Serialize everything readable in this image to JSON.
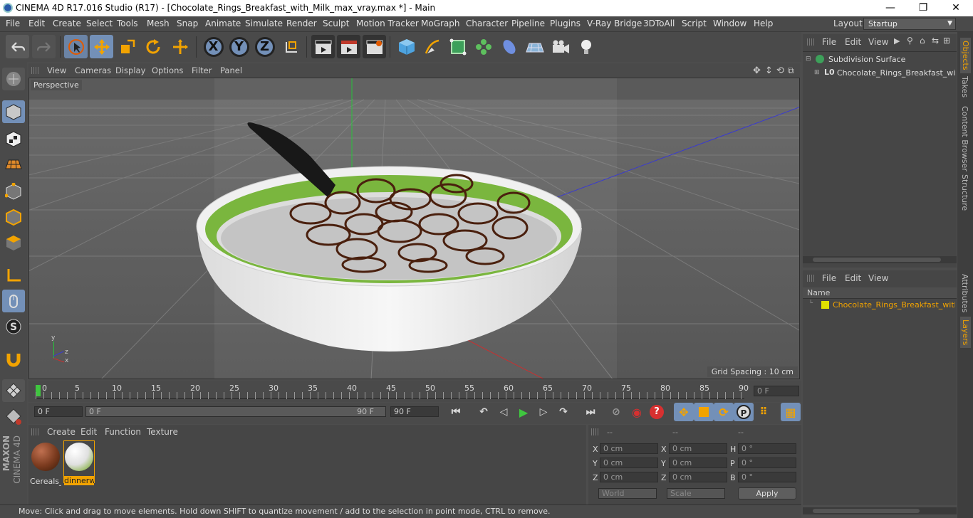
{
  "window": {
    "title": "CINEMA 4D R17.016 Studio (R17) - [Chocolate_Rings_Breakfast_with_Milk_max_vray.max *] - Main",
    "minimize": "—",
    "maximize": "❐",
    "close": "✕"
  },
  "menu": [
    "File",
    "Edit",
    "Create",
    "Select",
    "Tools",
    "Mesh",
    "Snap",
    "Animate",
    "Simulate",
    "Render",
    "Sculpt",
    "Motion Tracker",
    "MoGraph",
    "Character",
    "Pipeline",
    "Plugins",
    "V-Ray Bridge",
    "3DToAll",
    "Script",
    "Window",
    "Help"
  ],
  "layout": {
    "label": "Layout:",
    "value": "Startup"
  },
  "toolbar": {
    "x": "X",
    "y": "Y",
    "z": "Z"
  },
  "viewport": {
    "menu": [
      "View",
      "Cameras",
      "Display",
      "Options",
      "Filter",
      "Panel"
    ],
    "name": "Perspective",
    "grid_spacing": "Grid Spacing : 10 cm",
    "axis": {
      "y": "y",
      "z": "z",
      "x": "x"
    }
  },
  "timeline": {
    "ticks": [
      "0",
      "5",
      "10",
      "15",
      "20",
      "25",
      "30",
      "35",
      "40",
      "45",
      "50",
      "55",
      "60",
      "65",
      "70",
      "75",
      "80",
      "85",
      "90"
    ],
    "current_frame": "0 F"
  },
  "anim": {
    "start": "0 F",
    "range_start": "0 F",
    "range_end": "90 F",
    "end": "90 F"
  },
  "materials": {
    "menu": [
      "Create",
      "Edit",
      "Function",
      "Texture"
    ],
    "items": [
      {
        "label": "Cereals_",
        "color": "#7a3a1e"
      },
      {
        "label": "dinnerw",
        "color": "#e8e8e8"
      }
    ]
  },
  "coords": {
    "headers": [
      "--",
      "--",
      "--"
    ],
    "rows": [
      {
        "a": "X",
        "av": "0 cm",
        "b": "X",
        "bv": "0 cm",
        "c": "H",
        "cv": "0 °"
      },
      {
        "a": "Y",
        "av": "0 cm",
        "b": "Y",
        "bv": "0 cm",
        "c": "P",
        "cv": "0 °"
      },
      {
        "a": "Z",
        "av": "0 cm",
        "b": "Z",
        "bv": "0 cm",
        "c": "B",
        "cv": "0 °"
      }
    ],
    "world": "World",
    "scale": "Scale",
    "apply": "Apply"
  },
  "objects": {
    "menu": [
      "File",
      "Edit",
      "View"
    ],
    "items": [
      "Subdivision Surface",
      "Chocolate_Rings_Breakfast_with"
    ]
  },
  "layers": {
    "menu": [
      "File",
      "Edit",
      "View"
    ],
    "header": "Name",
    "items": [
      "Chocolate_Rings_Breakfast_with_I"
    ]
  },
  "sidetabs": [
    "Objects",
    "Takes",
    "Content Browser",
    "Structure",
    "Attributes",
    "Layers"
  ],
  "status": "Move: Click and drag to move elements. Hold down SHIFT to quantize movement / add to the selection in point mode, CTRL to remove.",
  "brand": {
    "maxon": "MAXON",
    "cinema": "CINEMA 4D"
  }
}
